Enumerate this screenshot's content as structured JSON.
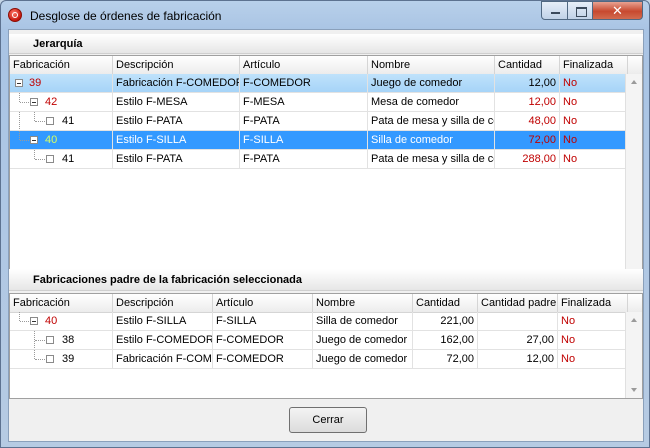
{
  "window": {
    "title": "Desglose de órdenes de fabricación",
    "close_glyph": "✕"
  },
  "jerarquia": {
    "title": "Jerarquía",
    "columns": [
      "Fabricación",
      "Descripción",
      "Artículo",
      "Nombre",
      "Cantidad",
      "Finalizada"
    ],
    "rows": [
      {
        "fab": "39",
        "desc": "Fabricación F-COMEDOR",
        "art": "F-COMEDOR",
        "nombre": "Juego de comedor",
        "cant": "12,00",
        "fin": "No"
      },
      {
        "fab": "42",
        "desc": "Estilo F-MESA",
        "art": "F-MESA",
        "nombre": "Mesa de comedor",
        "cant": "12,00",
        "fin": "No"
      },
      {
        "fab": "41",
        "desc": "Estilo F-PATA",
        "art": "F-PATA",
        "nombre": "Pata de mesa y silla de comedor",
        "cant": "48,00",
        "fin": "No"
      },
      {
        "fab": "40",
        "desc": "Estilo F-SILLA",
        "art": "F-SILLA",
        "nombre": "Silla de comedor",
        "cant": "72,00",
        "fin": "No"
      },
      {
        "fab": "41",
        "desc": "Estilo F-PATA",
        "art": "F-PATA",
        "nombre": "Pata de mesa y silla de comedor",
        "cant": "288,00",
        "fin": "No"
      }
    ]
  },
  "padres": {
    "title": "Fabricaciones padre de la fabricación seleccionada",
    "columns": [
      "Fabricación",
      "Descripción",
      "Artículo",
      "Nombre",
      "Cantidad",
      "Cantidad padre",
      "Finalizada"
    ],
    "rows": [
      {
        "fab": "40",
        "desc": "Estilo F-SILLA",
        "art": "F-SILLA",
        "nombre": "Silla de comedor",
        "cant": "221,00",
        "cant_padre": "",
        "fin": "No"
      },
      {
        "fab": "38",
        "desc": "Estilo F-COMEDOR",
        "art": "F-COMEDOR",
        "nombre": "Juego de comedor",
        "cant": "162,00",
        "cant_padre": "27,00",
        "fin": "No"
      },
      {
        "fab": "39",
        "desc": "Fabricación F-COMEDOR",
        "art": "F-COMEDOR",
        "nombre": "Juego de comedor",
        "cant": "72,00",
        "cant_padre": "12,00",
        "fin": "No"
      }
    ]
  },
  "buttons": {
    "cerrar": "Cerrar"
  },
  "colors": {
    "selected_row": "#3399ff",
    "highlight_row": "#a5d3f8",
    "no_text": "#c00000",
    "fab_red": "#c00000",
    "fab_green": "#6a8f00"
  }
}
